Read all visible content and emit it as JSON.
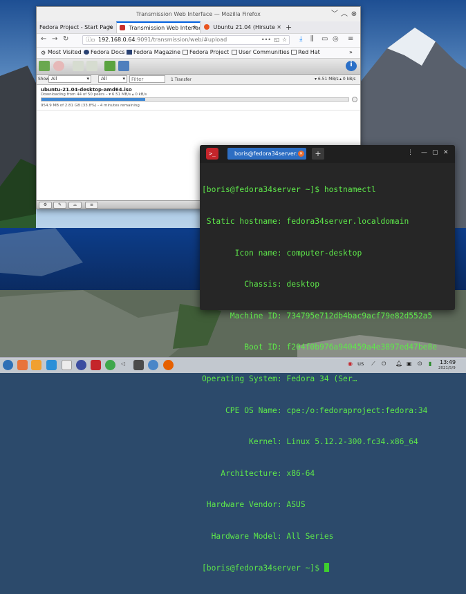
{
  "colors": {
    "terminal_text": "#5ee84a",
    "terminal_bg": "#262626",
    "progress_fill": "#3e87d3",
    "tab_accent": "#0060df"
  },
  "firefox": {
    "title": "Transmission Web Interface — Mozilla Firefox",
    "tabs": [
      {
        "label": "Fedora Project - Start Page",
        "close": "✕",
        "icon": "fedora-icon"
      },
      {
        "label": "Transmission Web Interface",
        "close": "✕",
        "icon": "transmission-icon"
      },
      {
        "label": "Ubuntu 21.04 (Hirsute",
        "close": "✕",
        "icon": "ubuntu-icon"
      }
    ],
    "new_tab": "+",
    "url_host": "192.168.0.64",
    "url_rest": ":9091/transmission/web/#upload",
    "url_more": "•••",
    "bookmarks": [
      {
        "label": "Most Visited",
        "icon": "gear-icon"
      },
      {
        "label": "Fedora Docs",
        "icon": "fedora-icon"
      },
      {
        "label": "Fedora Magazine",
        "icon": "fedora-icon"
      },
      {
        "label": "Fedora Project",
        "icon": "folder-icon"
      },
      {
        "label": "User Communities",
        "icon": "folder-icon"
      },
      {
        "label": "Red Hat",
        "icon": "folder-icon"
      }
    ],
    "bookmarks_overflow": "»"
  },
  "transmission": {
    "show_label": "Show",
    "filter_state": "All",
    "filter_tracker": "All",
    "filter_placeholder": "Filter",
    "transfer_count": "1 Transfer",
    "speed_down": "6.51 MB/s",
    "speed_up": "0 kB/s",
    "torrent": {
      "name": "ubuntu-21.04-desktop-amd64.iso",
      "peers": "Downloading from 44 of 50 peers – ▾ 6.51 MB/s ▴ 0 kB/s",
      "progress_text": "954.9 MB of 2.81 GB (33.8%) - 4 minutes remaining",
      "progress": 0.338
    }
  },
  "terminal": {
    "tab_title": "boris@fedora34server:~",
    "new_tab": "+",
    "lines": [
      "[boris@fedora34server ~]$ hostnamectl",
      " Static hostname: fedora34server.localdomain",
      "       Icon name: computer-desktop",
      "         Chassis: desktop",
      "      Machine ID: 734795e712db4bac9acf79e82d552a5",
      "         Boot ID: f204f0b976a940459a4e3897ed47be8e",
      "Operating System: Fedora 34 (Ser…",
      "     CPE OS Name: cpe:/o:fedoraproject:fedora:34",
      "          Kernel: Linux 5.12.2-300.fc34.x86_64",
      "    Architecture: x86-64",
      " Hardware Vendor: ASUS",
      "  Hardware Model: All Series"
    ],
    "prompt": "[boris@fedora34server ~]$ "
  },
  "taskbar": {
    "keyboard_layout": "us",
    "time": "13:49",
    "date": "2021/5/9"
  }
}
